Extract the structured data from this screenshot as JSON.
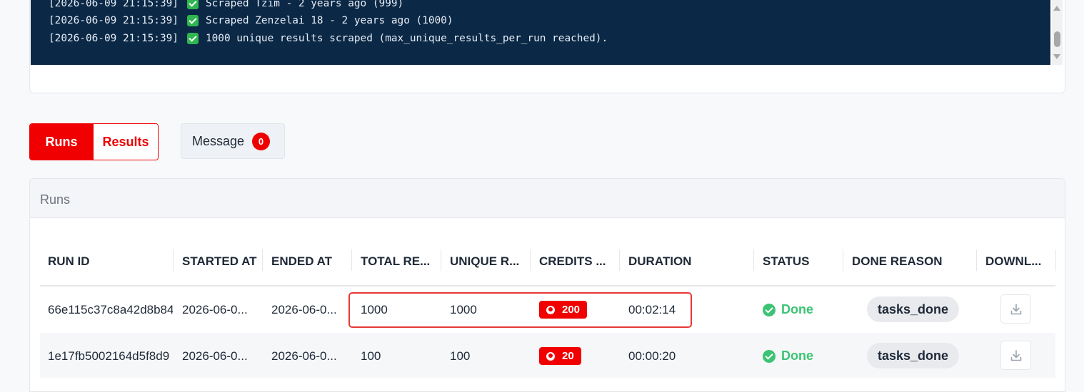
{
  "console": {
    "lines": [
      {
        "time": "[2026-06-09 21:15:39]",
        "text": "Scraped Tzim - 2 years ago (999)"
      },
      {
        "time": "[2026-06-09 21:15:39]",
        "text": "Scraped Zenzelai 18 - 2 years ago (1000)"
      },
      {
        "time": "[2026-06-09 21:15:39]",
        "text": "1000 unique results scraped (max_unique_results_per_run reached)."
      }
    ]
  },
  "tabs": {
    "runs_label": "Runs",
    "results_label": "Results",
    "message_label": "Message",
    "message_count": "0"
  },
  "runs_panel": {
    "title": "Runs",
    "columns": [
      "RUN ID",
      "STARTED AT",
      "ENDED AT",
      "TOTAL RE...",
      "UNIQUE R...",
      "CREDITS ...",
      "DURATION",
      "STATUS",
      "DONE REASON",
      "DOWNL..."
    ],
    "rows": [
      {
        "run_id": "66e115c37c8a42d8b84",
        "started_at": "2026-06-0...",
        "ended_at": "2026-06-0...",
        "total": "1000",
        "unique": "1000",
        "credits": "200",
        "duration": "00:02:14",
        "status": "Done",
        "done_reason": "tasks_done"
      },
      {
        "run_id": "1e17fb5002164d5f8d9",
        "started_at": "2026-06-0...",
        "ended_at": "2026-06-0...",
        "total": "100",
        "unique": "100",
        "credits": "20",
        "duration": "00:00:20",
        "status": "Done",
        "done_reason": "tasks_done"
      }
    ]
  },
  "colors": {
    "accent": "#f00000",
    "console_bg": "#0b2846",
    "done_green": "#3cc474",
    "highlight": "#e53935"
  }
}
